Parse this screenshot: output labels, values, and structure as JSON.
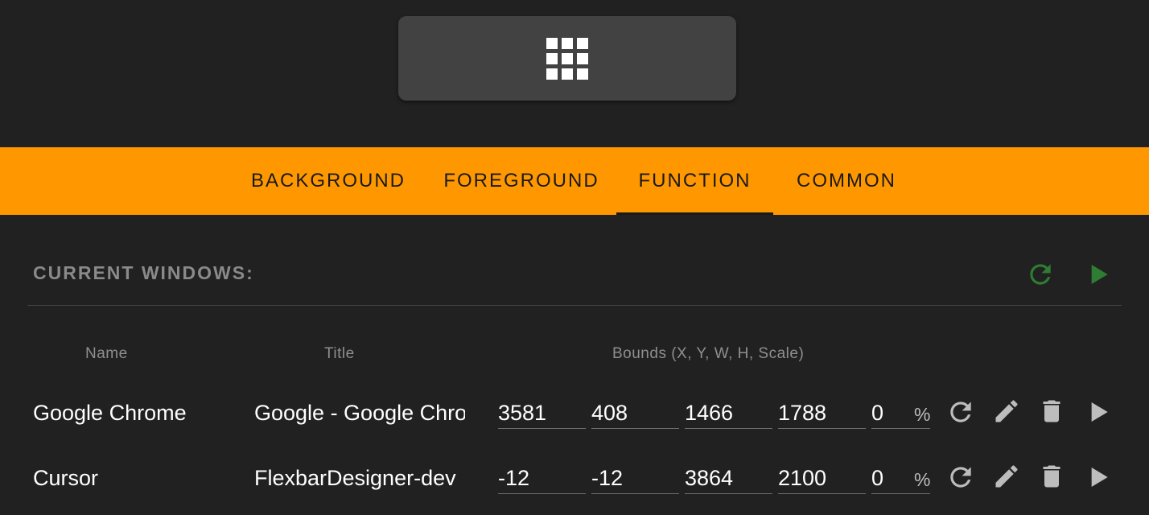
{
  "tabs": [
    {
      "label": "BACKGROUND",
      "active": false
    },
    {
      "label": "FOREGROUND",
      "active": false
    },
    {
      "label": "FUNCTION",
      "active": true
    },
    {
      "label": "COMMON",
      "active": false
    }
  ],
  "section": {
    "title": "CURRENT WINDOWS:",
    "icons": [
      "refresh-icon",
      "play-icon"
    ],
    "accent_color": "#2e7d32"
  },
  "columns": {
    "name": "Name",
    "title": "Title",
    "bounds": "Bounds (X, Y, W, H, Scale)"
  },
  "rows": [
    {
      "name": "Google Chrome",
      "title": "Google - Google Chrome",
      "x": "3581",
      "y": "408",
      "w": "1466",
      "h": "1788",
      "scale": "0",
      "unit": "%"
    },
    {
      "name": "Cursor",
      "title": "FlexbarDesigner-dev",
      "x": "-12",
      "y": "-12",
      "w": "3864",
      "h": "2100",
      "scale": "0",
      "unit": "%"
    }
  ],
  "row_actions": [
    "refresh-icon",
    "pencil-icon",
    "trash-icon",
    "play-icon"
  ],
  "colors": {
    "tab_bar": "#ff9800",
    "background": "#212121",
    "grid_button": "#424242"
  }
}
